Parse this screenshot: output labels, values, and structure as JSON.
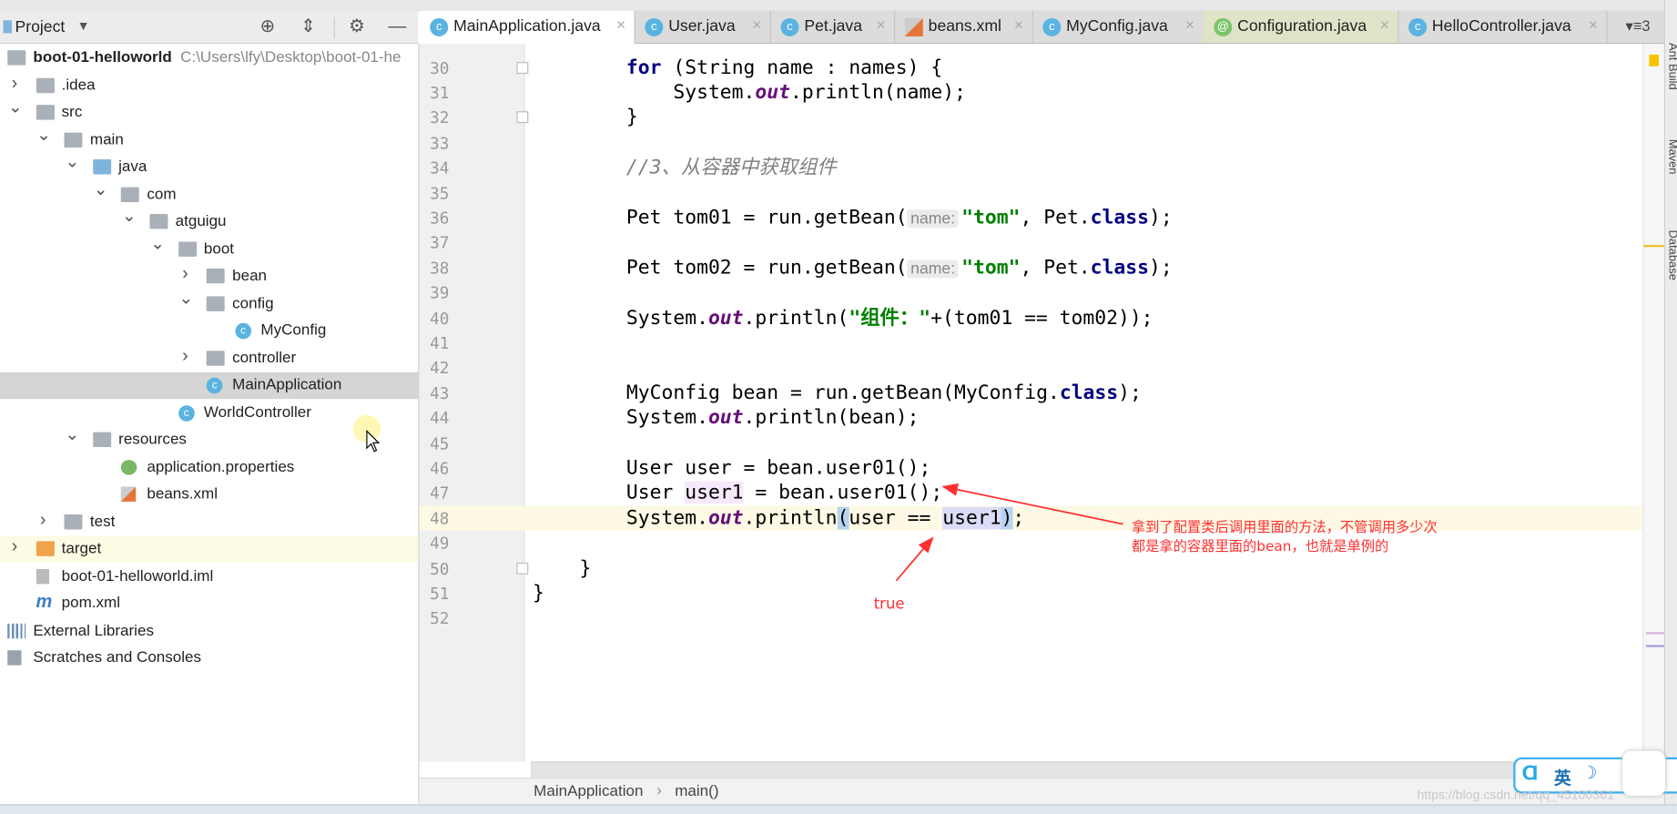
{
  "project_panel": {
    "title": "Project",
    "tree": [
      {
        "label": "boot-01-helloworld",
        "path": "C:\\Users\\lfy\\Desktop\\boot-01-he",
        "depth": 0,
        "arrow": "none",
        "icon": "module-icon",
        "bold": true
      },
      {
        "label": ".idea",
        "depth": 1,
        "arrow": "right",
        "icon": "folder-icon"
      },
      {
        "label": "src",
        "depth": 1,
        "arrow": "down",
        "icon": "folder-icon"
      },
      {
        "label": "main",
        "depth": 2,
        "arrow": "down",
        "icon": "folder-icon"
      },
      {
        "label": "java",
        "depth": 3,
        "arrow": "down",
        "icon": "source-folder-icon"
      },
      {
        "label": "com",
        "depth": 4,
        "arrow": "down",
        "icon": "package-icon"
      },
      {
        "label": "atguigu",
        "depth": 5,
        "arrow": "down",
        "icon": "package-icon"
      },
      {
        "label": "boot",
        "depth": 6,
        "arrow": "down",
        "icon": "package-icon"
      },
      {
        "label": "bean",
        "depth": 7,
        "arrow": "right",
        "icon": "package-icon"
      },
      {
        "label": "config",
        "depth": 7,
        "arrow": "down",
        "icon": "package-icon"
      },
      {
        "label": "MyConfig",
        "depth": 8,
        "arrow": "none",
        "icon": "class-icon"
      },
      {
        "label": "controller",
        "depth": 7,
        "arrow": "right",
        "icon": "package-icon"
      },
      {
        "label": "MainApplication",
        "depth": 7,
        "arrow": "none",
        "icon": "spring-boot-class-icon",
        "selected": true
      },
      {
        "label": "WorldController",
        "depth": 6,
        "arrow": "none",
        "icon": "class-icon"
      },
      {
        "label": "resources",
        "depth": 3,
        "arrow": "down",
        "icon": "resources-folder-icon"
      },
      {
        "label": "application.properties",
        "depth": 4,
        "arrow": "none",
        "icon": "properties-file-icon"
      },
      {
        "label": "beans.xml",
        "depth": 4,
        "arrow": "none",
        "icon": "xml-file-icon"
      },
      {
        "label": "test",
        "depth": 2,
        "arrow": "right",
        "icon": "folder-icon"
      },
      {
        "label": "target",
        "depth": 1,
        "arrow": "right",
        "icon": "excluded-folder-icon",
        "highlight": true
      },
      {
        "label": "boot-01-helloworld.iml",
        "depth": 1,
        "arrow": "none",
        "icon": "iml-file-icon"
      },
      {
        "label": "pom.xml",
        "depth": 1,
        "arrow": "none",
        "icon": "maven-icon"
      },
      {
        "label": "External Libraries",
        "depth": 0,
        "arrow": "none",
        "icon": "libraries-icon"
      },
      {
        "label": "Scratches and Consoles",
        "depth": 0,
        "arrow": "none",
        "icon": "scratches-icon"
      }
    ]
  },
  "tabs": [
    {
      "label": "MainApplication.java",
      "icon": "spring-boot-class-icon",
      "active": true
    },
    {
      "label": "User.java",
      "icon": "class-icon"
    },
    {
      "label": "Pet.java",
      "icon": "class-icon"
    },
    {
      "label": "beans.xml",
      "icon": "xml-file-icon"
    },
    {
      "label": "MyConfig.java",
      "icon": "class-icon"
    },
    {
      "label": "Configuration.java",
      "icon": "annotation-icon",
      "green": true
    },
    {
      "label": "HelloController.java",
      "icon": "class-icon"
    }
  ],
  "tab_overflow": "▾≡3",
  "editor": {
    "current_line": 48,
    "lines": [
      {
        "n": 30,
        "fold": true,
        "tokens": [
          [
            "        ",
            ""
          ],
          [
            "for",
            "kw"
          ],
          [
            " (String name : names) {",
            ""
          ]
        ]
      },
      {
        "n": 31,
        "tokens": [
          [
            "            System.",
            ""
          ],
          [
            "out",
            "sf"
          ],
          [
            ".println(name);",
            ""
          ]
        ]
      },
      {
        "n": 32,
        "fold": true,
        "tokens": [
          [
            "        }",
            ""
          ]
        ]
      },
      {
        "n": 33,
        "tokens": []
      },
      {
        "n": 34,
        "tokens": [
          [
            "        ",
            ""
          ],
          [
            "//3、从容器中获取组件",
            "cm"
          ]
        ]
      },
      {
        "n": 35,
        "tokens": []
      },
      {
        "n": 36,
        "tokens": [
          [
            "        Pet tom01 = run.getBean(",
            ""
          ],
          [
            "name:",
            "hint"
          ],
          [
            "\"tom\"",
            "st"
          ],
          [
            ", Pet.",
            ""
          ],
          [
            "class",
            "kw"
          ],
          [
            ");",
            ""
          ]
        ]
      },
      {
        "n": 37,
        "tokens": []
      },
      {
        "n": 38,
        "tokens": [
          [
            "        Pet tom02 = run.getBean(",
            ""
          ],
          [
            "name:",
            "hint"
          ],
          [
            "\"tom\"",
            "st"
          ],
          [
            ", Pet.",
            ""
          ],
          [
            "class",
            "kw"
          ],
          [
            ");",
            ""
          ]
        ]
      },
      {
        "n": 39,
        "tokens": []
      },
      {
        "n": 40,
        "tokens": [
          [
            "        System.",
            ""
          ],
          [
            "out",
            "sf"
          ],
          [
            ".println(",
            ""
          ],
          [
            "\"组件：\"",
            "st"
          ],
          [
            "+(tom01 == tom02));",
            ""
          ]
        ]
      },
      {
        "n": 41,
        "tokens": []
      },
      {
        "n": 42,
        "tokens": []
      },
      {
        "n": 43,
        "tokens": [
          [
            "        MyConfig bean = run.getBean(MyConfig.",
            ""
          ],
          [
            "class",
            "kw"
          ],
          [
            ");",
            ""
          ]
        ]
      },
      {
        "n": 44,
        "tokens": [
          [
            "        System.",
            ""
          ],
          [
            "out",
            "sf"
          ],
          [
            ".println(bean);",
            ""
          ]
        ]
      },
      {
        "n": 45,
        "tokens": []
      },
      {
        "n": 46,
        "tokens": [
          [
            "        User user = bean.user01();",
            ""
          ]
        ]
      },
      {
        "n": 47,
        "tokens": [
          [
            "        User ",
            ""
          ],
          [
            "user1",
            "use1"
          ],
          [
            " = bean.user01();",
            ""
          ]
        ]
      },
      {
        "n": 48,
        "tokens": [
          [
            "        System.",
            ""
          ],
          [
            "out",
            "sf"
          ],
          [
            ".println",
            ""
          ],
          [
            "(",
            "brace"
          ],
          [
            "user == ",
            ""
          ],
          [
            "user1",
            "use2"
          ],
          [
            ")",
            "brace"
          ],
          [
            ";",
            ""
          ]
        ]
      },
      {
        "n": 49,
        "tokens": []
      },
      {
        "n": 50,
        "fold": true,
        "tokens": [
          [
            "    }",
            ""
          ]
        ]
      },
      {
        "n": 51,
        "tokens": [
          [
            "}",
            ""
          ]
        ]
      },
      {
        "n": 52,
        "tokens": []
      }
    ]
  },
  "breadcrumb": {
    "items": [
      "MainApplication",
      "main()"
    ],
    "separator": "›"
  },
  "tool_windows": [
    "Ant Build",
    "Maven",
    "Database"
  ],
  "annotations": {
    "note_line1": "拿到了配置类后调用里面的方法，不管调用多少次",
    "note_line2": "都是拿的容器里面的bean，也就是单例的",
    "result": "true",
    "color": "#ff3030"
  },
  "ime": {
    "label": "英"
  },
  "watermark": "https://blog.csdn.net/qq_45100361"
}
